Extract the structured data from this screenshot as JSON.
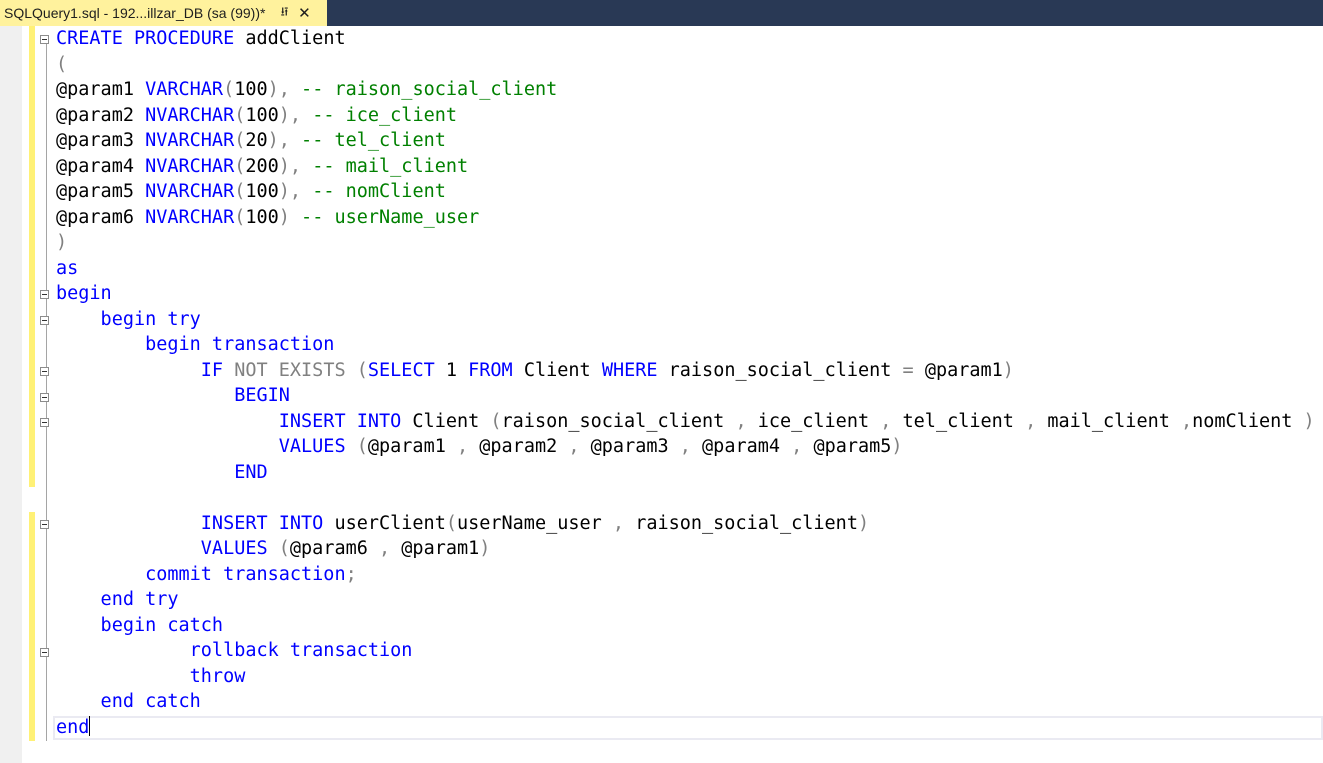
{
  "tab": {
    "title": "SQLQuery1.sql - 192...illzar_DB (sa (99))*",
    "pin_icon": "pin-icon",
    "close_icon": "close-icon"
  },
  "colors": {
    "keyword": "#0000ff",
    "comment": "#008000",
    "operator": "#808080",
    "tab_background": "#fff29d",
    "change_bar": "#fff176"
  },
  "code_lines": [
    [
      {
        "t": "CREATE PROCEDURE",
        "c": "kw"
      },
      {
        "t": " addClient",
        "c": ""
      }
    ],
    [
      {
        "t": "(",
        "c": "gr"
      }
    ],
    [
      {
        "t": "@param1 ",
        "c": ""
      },
      {
        "t": "VARCHAR",
        "c": "kw"
      },
      {
        "t": "(",
        "c": "gr"
      },
      {
        "t": "100",
        "c": ""
      },
      {
        "t": "),",
        "c": "gr"
      },
      {
        "t": " -- raison_social_client",
        "c": "cm"
      }
    ],
    [
      {
        "t": "@param2 ",
        "c": ""
      },
      {
        "t": "NVARCHAR",
        "c": "kw"
      },
      {
        "t": "(",
        "c": "gr"
      },
      {
        "t": "100",
        "c": ""
      },
      {
        "t": "),",
        "c": "gr"
      },
      {
        "t": " -- ice_client",
        "c": "cm"
      }
    ],
    [
      {
        "t": "@param3 ",
        "c": ""
      },
      {
        "t": "NVARCHAR",
        "c": "kw"
      },
      {
        "t": "(",
        "c": "gr"
      },
      {
        "t": "20",
        "c": ""
      },
      {
        "t": "),",
        "c": "gr"
      },
      {
        "t": " -- tel_client",
        "c": "cm"
      }
    ],
    [
      {
        "t": "@param4 ",
        "c": ""
      },
      {
        "t": "NVARCHAR",
        "c": "kw"
      },
      {
        "t": "(",
        "c": "gr"
      },
      {
        "t": "200",
        "c": ""
      },
      {
        "t": "),",
        "c": "gr"
      },
      {
        "t": " -- mail_client",
        "c": "cm"
      }
    ],
    [
      {
        "t": "@param5 ",
        "c": ""
      },
      {
        "t": "NVARCHAR",
        "c": "kw"
      },
      {
        "t": "(",
        "c": "gr"
      },
      {
        "t": "100",
        "c": ""
      },
      {
        "t": "),",
        "c": "gr"
      },
      {
        "t": " -- nomClient",
        "c": "cm"
      }
    ],
    [
      {
        "t": "@param6 ",
        "c": ""
      },
      {
        "t": "NVARCHAR",
        "c": "kw"
      },
      {
        "t": "(",
        "c": "gr"
      },
      {
        "t": "100",
        "c": ""
      },
      {
        "t": ")",
        "c": "gr"
      },
      {
        "t": " -- userName_user",
        "c": "cm"
      }
    ],
    [
      {
        "t": ")",
        "c": "gr"
      }
    ],
    [
      {
        "t": "as",
        "c": "kw"
      }
    ],
    [
      {
        "t": "begin",
        "c": "kw"
      }
    ],
    [
      {
        "t": "    begin try",
        "c": "kw"
      }
    ],
    [
      {
        "t": "        begin transaction",
        "c": "kw"
      }
    ],
    [
      {
        "t": "             IF ",
        "c": "kw"
      },
      {
        "t": "NOT EXISTS ",
        "c": "gr"
      },
      {
        "t": "(",
        "c": "gr"
      },
      {
        "t": "SELECT ",
        "c": "kw"
      },
      {
        "t": "1 ",
        "c": ""
      },
      {
        "t": "FROM ",
        "c": "kw"
      },
      {
        "t": "Client ",
        "c": ""
      },
      {
        "t": "WHERE ",
        "c": "kw"
      },
      {
        "t": "raison_social_client ",
        "c": ""
      },
      {
        "t": "= ",
        "c": "gr"
      },
      {
        "t": "@param1",
        "c": ""
      },
      {
        "t": ")",
        "c": "gr"
      }
    ],
    [
      {
        "t": "                BEGIN",
        "c": "kw"
      }
    ],
    [
      {
        "t": "                    INSERT INTO ",
        "c": "kw"
      },
      {
        "t": "Client ",
        "c": ""
      },
      {
        "t": "(",
        "c": "gr"
      },
      {
        "t": "raison_social_client ",
        "c": ""
      },
      {
        "t": ", ",
        "c": "gr"
      },
      {
        "t": "ice_client ",
        "c": ""
      },
      {
        "t": ", ",
        "c": "gr"
      },
      {
        "t": "tel_client ",
        "c": ""
      },
      {
        "t": ", ",
        "c": "gr"
      },
      {
        "t": "mail_client ",
        "c": ""
      },
      {
        "t": ",",
        "c": "gr"
      },
      {
        "t": "nomClient ",
        "c": ""
      },
      {
        "t": ")",
        "c": "gr"
      }
    ],
    [
      {
        "t": "                    VALUES ",
        "c": "kw"
      },
      {
        "t": "(",
        "c": "gr"
      },
      {
        "t": "@param1 ",
        "c": ""
      },
      {
        "t": ", ",
        "c": "gr"
      },
      {
        "t": "@param2 ",
        "c": ""
      },
      {
        "t": ", ",
        "c": "gr"
      },
      {
        "t": "@param3 ",
        "c": ""
      },
      {
        "t": ", ",
        "c": "gr"
      },
      {
        "t": "@param4 ",
        "c": ""
      },
      {
        "t": ", ",
        "c": "gr"
      },
      {
        "t": "@param5",
        "c": ""
      },
      {
        "t": ")",
        "c": "gr"
      }
    ],
    [
      {
        "t": "                END",
        "c": "kw"
      }
    ],
    [
      {
        "t": "",
        "c": ""
      }
    ],
    [
      {
        "t": "             INSERT INTO ",
        "c": "kw"
      },
      {
        "t": "userClient",
        "c": ""
      },
      {
        "t": "(",
        "c": "gr"
      },
      {
        "t": "userName_user ",
        "c": ""
      },
      {
        "t": ", ",
        "c": "gr"
      },
      {
        "t": "raison_social_client",
        "c": ""
      },
      {
        "t": ")",
        "c": "gr"
      }
    ],
    [
      {
        "t": "             VALUES ",
        "c": "kw"
      },
      {
        "t": "(",
        "c": "gr"
      },
      {
        "t": "@param6 ",
        "c": ""
      },
      {
        "t": ", ",
        "c": "gr"
      },
      {
        "t": "@param1",
        "c": ""
      },
      {
        "t": ")",
        "c": "gr"
      }
    ],
    [
      {
        "t": "        commit transaction",
        "c": "kw"
      },
      {
        "t": ";",
        "c": "gr"
      }
    ],
    [
      {
        "t": "    end try",
        "c": "kw"
      }
    ],
    [
      {
        "t": "    begin catch",
        "c": "kw"
      }
    ],
    [
      {
        "t": "            rollback transaction",
        "c": "kw"
      }
    ],
    [
      {
        "t": "            throw",
        "c": "kw"
      }
    ],
    [
      {
        "t": "    end catch",
        "c": "kw"
      }
    ],
    [
      {
        "t": "end",
        "c": "kw"
      }
    ]
  ]
}
